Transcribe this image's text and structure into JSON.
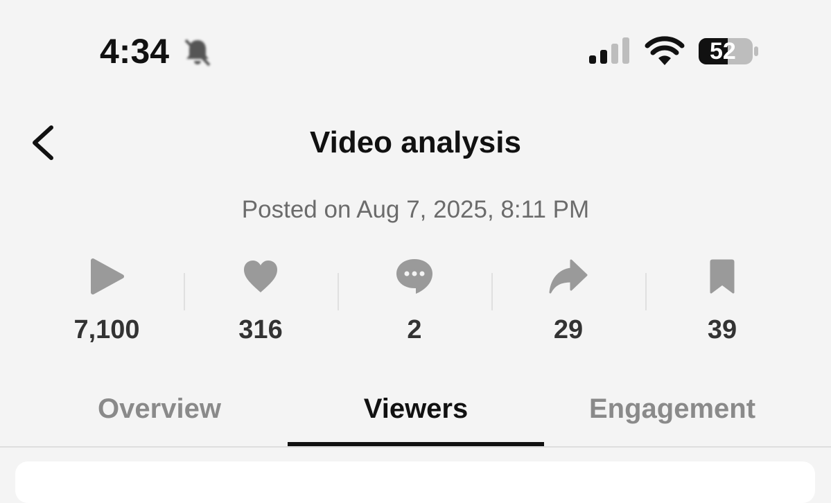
{
  "status_bar": {
    "time": "4:34",
    "battery_level": "52",
    "icons": [
      "bell-muted-icon",
      "cellular-signal-icon",
      "wifi-icon",
      "battery-icon"
    ]
  },
  "header": {
    "title": "Video analysis",
    "back_icon": "chevron-left-icon"
  },
  "posted_text": "Posted on Aug 7, 2025, 8:11 PM",
  "stats": [
    {
      "icon": "play-icon",
      "value": "7,100"
    },
    {
      "icon": "heart-icon",
      "value": "316"
    },
    {
      "icon": "comment-icon",
      "value": "2"
    },
    {
      "icon": "share-icon",
      "value": "29"
    },
    {
      "icon": "bookmark-icon",
      "value": "39"
    }
  ],
  "tabs": [
    {
      "label": "Overview",
      "active": false
    },
    {
      "label": "Viewers",
      "active": true
    },
    {
      "label": "Engagement",
      "active": false
    }
  ],
  "colors": {
    "background": "#f4f4f4",
    "icon_gray": "#9a9a9a",
    "text_primary": "#111111",
    "text_secondary": "#6b6b6b",
    "tab_inactive": "#8a8a8a"
  }
}
